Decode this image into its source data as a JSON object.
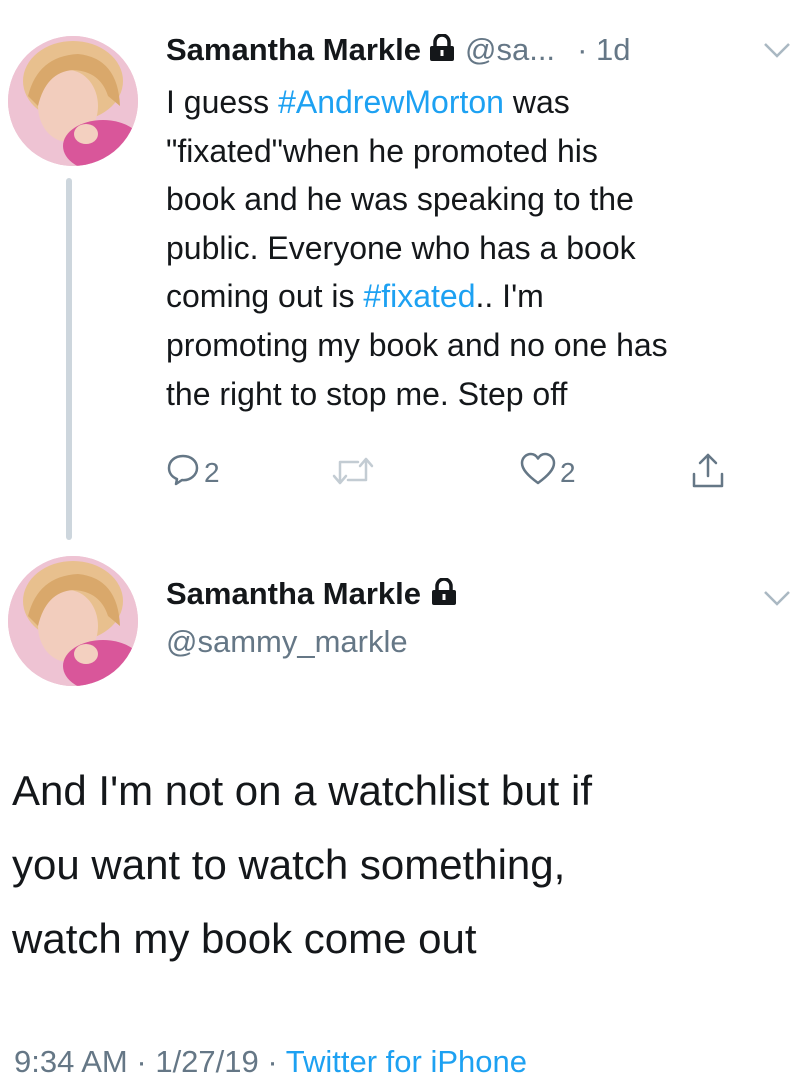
{
  "reply_tweet": {
    "author_name": "Samantha Markle",
    "author_handle": "@sa...",
    "time_ago": "· 1d",
    "text_parts": [
      {
        "text": "I guess ",
        "is_tag": false
      },
      {
        "text": "#AndrewMorton",
        "is_tag": true
      },
      {
        "text": " was \"fixated\"when he promoted his book and he was speaking to the public. Everyone who has a book coming out is ",
        "is_tag": false
      },
      {
        "text": "#fixated",
        "is_tag": true
      },
      {
        "text": ".. I'm promoting my book and no one has the right to stop me. Step off",
        "is_tag": false
      }
    ],
    "lines": [
      "I guess #AndrewMorton was",
      "\"fixated\"when he promoted his",
      "book and he was speaking to the",
      "public. Everyone who has a book",
      "coming out is #fixated.. I'm",
      "promoting my book and no one has",
      "the right to stop me. Step off"
    ],
    "reply_count": "2",
    "like_count": "2"
  },
  "main_tweet": {
    "author_name": "Samantha Markle",
    "author_handle": "@sammy_markle",
    "lines": [
      "And I'm not on a watchlist but if",
      "you want to watch something,",
      "watch my book come out"
    ],
    "time": "9:34 AM",
    "date": "1/27/19",
    "separator": "·",
    "client": "Twitter for iPhone"
  },
  "icons": {
    "lock": "lock-icon",
    "chevron": "chevron-down-icon",
    "reply": "reply-icon",
    "retweet": "retweet-icon",
    "like": "like-icon",
    "share": "share-icon"
  },
  "colors": {
    "text": "#14171a",
    "secondary": "#657786",
    "link": "#1da1f2",
    "thread_line": "#cdd6dd"
  }
}
